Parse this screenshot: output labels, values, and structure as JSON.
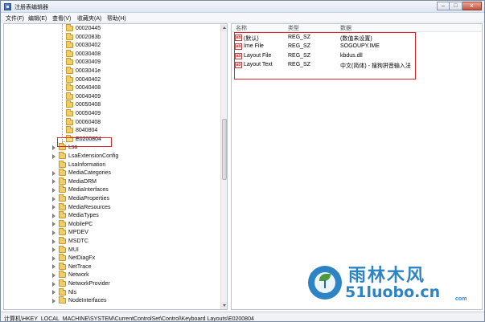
{
  "window": {
    "title": "注册表编辑器",
    "controls": {
      "minimize": "–",
      "maximize": "□",
      "close": "x"
    }
  },
  "menu": [
    "文件(F)",
    "编辑(E)",
    "查看(V)",
    "收藏夹(A)",
    "帮助(H)"
  ],
  "tree": {
    "items": [
      {
        "label": "00020445",
        "expandable": false,
        "level": 2
      },
      {
        "label": "0002083b",
        "expandable": false,
        "level": 2
      },
      {
        "label": "00030402",
        "expandable": false,
        "level": 2
      },
      {
        "label": "00030408",
        "expandable": false,
        "level": 2
      },
      {
        "label": "00030409",
        "expandable": false,
        "level": 2
      },
      {
        "label": "0003041e",
        "expandable": false,
        "level": 2
      },
      {
        "label": "00040402",
        "expandable": false,
        "level": 2
      },
      {
        "label": "00040408",
        "expandable": false,
        "level": 2
      },
      {
        "label": "00040409",
        "expandable": false,
        "level": 2
      },
      {
        "label": "00050408",
        "expandable": false,
        "level": 2
      },
      {
        "label": "00050409",
        "expandable": false,
        "level": 2
      },
      {
        "label": "00060408",
        "expandable": false,
        "level": 2
      },
      {
        "label": "8040804",
        "expandable": false,
        "level": 2
      },
      {
        "label": "E0200804",
        "expandable": false,
        "level": 2,
        "selected": true
      },
      {
        "label": "Lsa",
        "expandable": true,
        "level": 1
      },
      {
        "label": "LsaExtensionConfig",
        "expandable": true,
        "level": 1
      },
      {
        "label": "LsaInformation",
        "expandable": false,
        "level": 1
      },
      {
        "label": "MediaCategories",
        "expandable": true,
        "level": 1
      },
      {
        "label": "MediaDRM",
        "expandable": true,
        "level": 1
      },
      {
        "label": "MediaInterfaces",
        "expandable": true,
        "level": 1
      },
      {
        "label": "MediaProperties",
        "expandable": true,
        "level": 1
      },
      {
        "label": "MediaResources",
        "expandable": true,
        "level": 1
      },
      {
        "label": "MediaTypes",
        "expandable": true,
        "level": 1
      },
      {
        "label": "MobilePC",
        "expandable": true,
        "level": 1
      },
      {
        "label": "MPDEV",
        "expandable": true,
        "level": 1
      },
      {
        "label": "MSDTC",
        "expandable": true,
        "level": 1
      },
      {
        "label": "MUI",
        "expandable": true,
        "level": 1
      },
      {
        "label": "NetDiagFx",
        "expandable": true,
        "level": 1
      },
      {
        "label": "NetTrace",
        "expandable": true,
        "level": 1
      },
      {
        "label": "Network",
        "expandable": true,
        "level": 1
      },
      {
        "label": "NetworkProvider",
        "expandable": true,
        "level": 1
      },
      {
        "label": "Nls",
        "expandable": true,
        "level": 1
      },
      {
        "label": "NodeInterfaces",
        "expandable": true,
        "level": 1
      }
    ]
  },
  "list": {
    "headers": {
      "name": "名称",
      "type": "类型",
      "data": "数据"
    },
    "rows": [
      {
        "name": "(默认)",
        "type": "REG_SZ",
        "data": "(数值未设置)"
      },
      {
        "name": "Ime File",
        "type": "REG_SZ",
        "data": "SOGOUPY.IME"
      },
      {
        "name": "Layout File",
        "type": "REG_SZ",
        "data": "kbdus.dll"
      },
      {
        "name": "Layout Text",
        "type": "REG_SZ",
        "data": "中文(简体) - 搜狗拼音输入法"
      }
    ],
    "value_icon_text": "ab"
  },
  "status": {
    "path": "计算机\\HKEY_LOCAL_MACHINE\\SYSTEM\\CurrentControlSet\\Control\\Keyboard Layouts\\E0200804"
  },
  "watermark": {
    "brand_cn": "雨林木风",
    "url": "51luobo.cn",
    "url_suffix": "com"
  },
  "colors": {
    "highlight_border": "#d9262b",
    "folder": "#f0cd6a",
    "watermark_blue": "#2c84c4"
  }
}
